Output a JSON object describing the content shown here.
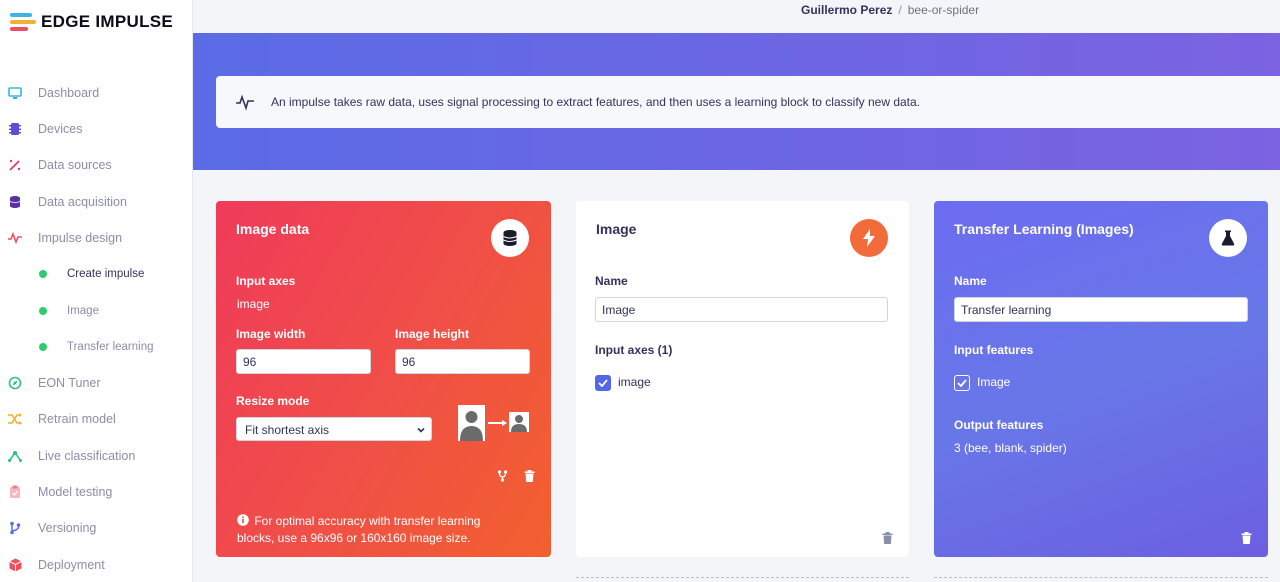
{
  "app": {
    "brand": "EDGE IMPULSE"
  },
  "breadcrumb": {
    "user": "Guillermo Perez",
    "separator": "/",
    "project": "bee-or-spider"
  },
  "sidebar": {
    "items": [
      {
        "label": "Dashboard",
        "icon": "monitor-icon"
      },
      {
        "label": "Devices",
        "icon": "chip-icon"
      },
      {
        "label": "Data sources",
        "icon": "magic-wand-icon"
      },
      {
        "label": "Data acquisition",
        "icon": "database-icon"
      },
      {
        "label": "Impulse design",
        "icon": "pulse-icon"
      },
      {
        "label": "Create impulse",
        "icon": "dot-icon"
      },
      {
        "label": "Image",
        "icon": "dot-icon"
      },
      {
        "label": "Transfer learning",
        "icon": "dot-icon"
      },
      {
        "label": "EON Tuner",
        "icon": "compass-icon"
      },
      {
        "label": "Retrain model",
        "icon": "shuffle-icon"
      },
      {
        "label": "Live classification",
        "icon": "network-icon"
      },
      {
        "label": "Model testing",
        "icon": "clipboard-icon"
      },
      {
        "label": "Versioning",
        "icon": "branch-icon"
      },
      {
        "label": "Deployment",
        "icon": "package-icon"
      }
    ]
  },
  "info": {
    "text": "An impulse takes raw data, uses signal processing to extract features, and then uses a learning block to classify new data."
  },
  "input_block": {
    "title": "Image data",
    "axes_label": "Input axes",
    "axes_value": "image",
    "width_label": "Image width",
    "width_value": "96",
    "height_label": "Image height",
    "height_value": "96",
    "resize_label": "Resize mode",
    "resize_value": "Fit shortest axis",
    "note": "For optimal accuracy with transfer learning blocks, use a 96x96 or 160x160 image size."
  },
  "processing_block": {
    "title": "Image",
    "name_label": "Name",
    "name_value": "Image",
    "axes_label": "Input axes (1)",
    "axis_item": "image",
    "axis_checked": true
  },
  "learning_block": {
    "title": "Transfer Learning (Images)",
    "name_label": "Name",
    "name_value": "Transfer learning",
    "features_label": "Input features",
    "feature_item": "Image",
    "feature_checked": true,
    "output_label": "Output features",
    "output_value": "3 (bee, blank, spider)"
  },
  "colors": {
    "brand_blue": "#5b6be6",
    "input_red": "#ef3b5a",
    "processing_orange": "#f26b3a",
    "learning_purple": "#6c6cf0",
    "active_green": "#2ecc71"
  }
}
